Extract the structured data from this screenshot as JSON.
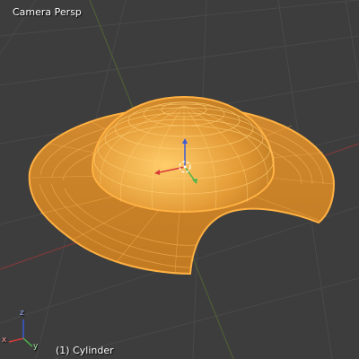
{
  "viewport": {
    "view_name": "Camera Persp",
    "active_object": "(1) Cylinder",
    "background_color": "#3d3d3d",
    "grid_color": "#4a4a4a",
    "x_axis_line_color": "#7a3a3a",
    "y_axis_line_color": "#5e7a2e",
    "selection_color": "#f5a331",
    "mesh_fill_color": "#d98b2b",
    "wire_color": "#ffb142"
  },
  "gizmo_axes": [
    "x",
    "y",
    "z"
  ],
  "gizmo_colors": {
    "x": "#d63a3a",
    "y": "#4bb34b",
    "z": "#3a5ad6"
  },
  "mesh": {
    "name": "Cylinder",
    "selected": true
  }
}
